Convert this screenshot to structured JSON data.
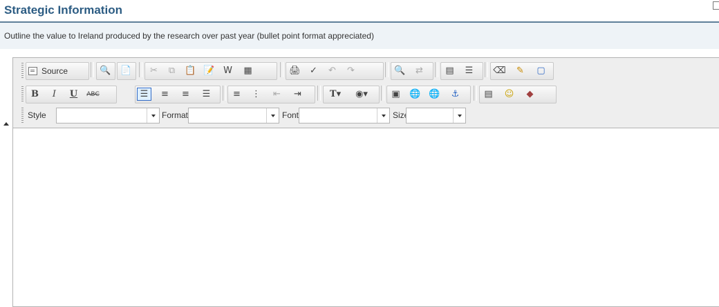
{
  "section": {
    "title": "Strategic Information",
    "instruction": "Outline the value to Ireland produced by the research over past year (bullet point format appreciated)"
  },
  "editor": {
    "toolbar": {
      "source_label": "Source",
      "style_label": "Style",
      "format_label": "Format",
      "font_label": "Font",
      "size_label": "Size",
      "style_value": "",
      "format_value": "",
      "font_value": "",
      "size_value": ""
    },
    "content": ""
  },
  "icons": {
    "row1": [
      "document-source-icon",
      "preview-icon",
      "templates-icon",
      "cut-icon",
      "copy-icon",
      "paste-icon",
      "paste-text-icon",
      "paste-word-icon",
      "select-all-icon",
      "print-icon",
      "spellcheck-icon",
      "undo-icon",
      "redo-icon",
      "find-icon",
      "replace-icon",
      "table-icon",
      "horizontal-rule-icon",
      "remove-format-icon",
      "highlight-icon",
      "maximize-icon"
    ],
    "row2": [
      "bold-icon",
      "italic-icon",
      "underline-icon",
      "strikethrough-icon",
      "align-left-icon",
      "align-center-icon",
      "align-right-icon",
      "justify-icon",
      "numbered-list-icon",
      "bulleted-list-icon",
      "outdent-icon",
      "indent-icon",
      "text-color-icon",
      "background-color-icon",
      "image-icon",
      "link-icon",
      "unlink-icon",
      "anchor-icon",
      "page-break-icon",
      "smiley-icon",
      "special-char-icon"
    ]
  },
  "colors": {
    "title": "#2c5c83",
    "rule": "#5e7f99",
    "instruction_bg": "#eef3f7",
    "toolbar_bg": "#eeeeee",
    "active_button": "#316ac5"
  }
}
